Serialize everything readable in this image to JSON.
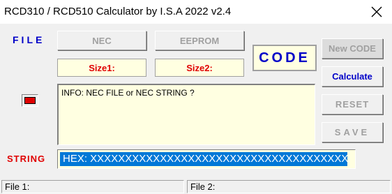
{
  "window": {
    "title": "RCD310 / RCD510 Calculator by I.S.A 2022 v2.4"
  },
  "labels": {
    "file": "FILE",
    "string": "STRING",
    "code": "CODE"
  },
  "buttons": {
    "nec": "NEC",
    "eeprom": "EEPROM",
    "new_code": "New CODE",
    "calculate": "Calculate",
    "reset": "RESET",
    "save": "SAVE"
  },
  "sizes": {
    "size1": "Size1:",
    "size2": "Size2:"
  },
  "info": {
    "text": "INFO: NEC FILE or NEC STRING ?"
  },
  "hex_input": {
    "value": "HEX: XXXXXXXXXXXXXXXXXXXXXXXXXXXXXXXXXXXXXXXX"
  },
  "statusbar": {
    "file1": "File 1:",
    "file2": "File 2:"
  },
  "colors": {
    "accent_blue": "#0000c8",
    "alert_red": "#e00000",
    "info_bg": "#ffffe1",
    "selection": "#0078d7"
  }
}
